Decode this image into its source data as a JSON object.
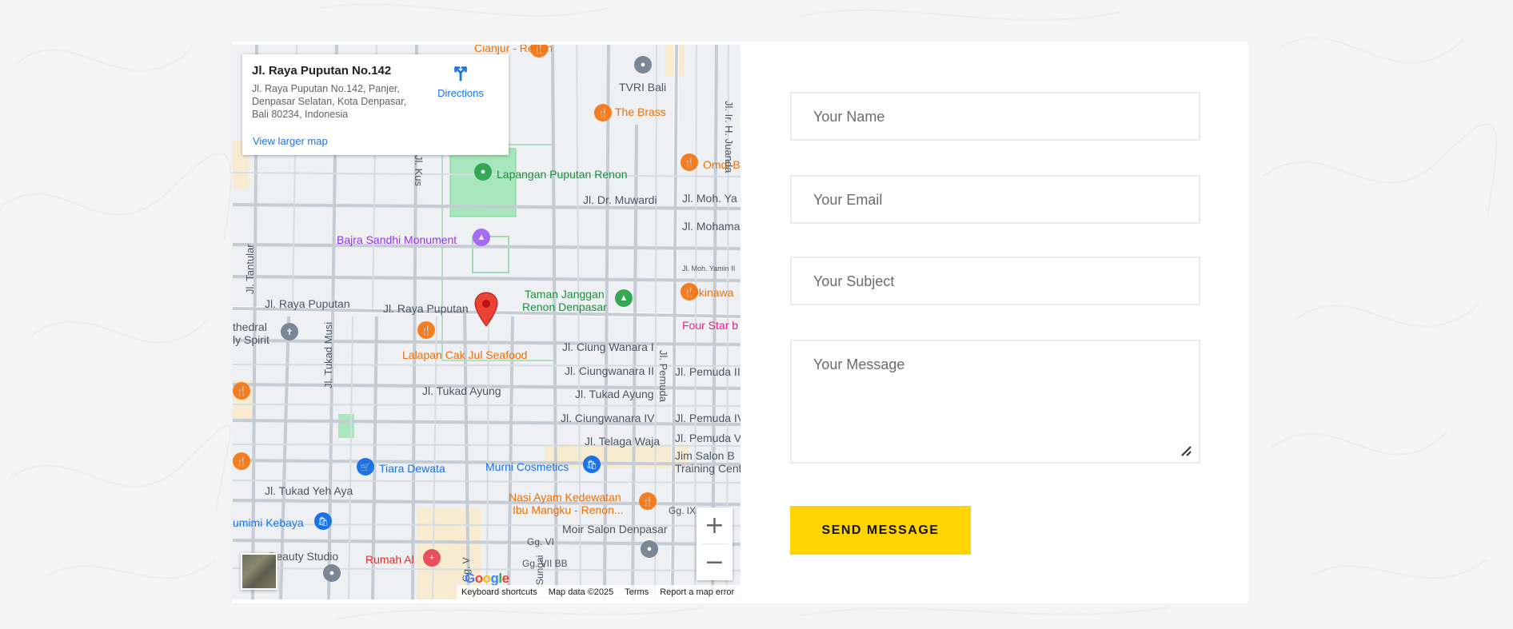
{
  "map": {
    "place_title": "Jl. Raya Puputan No.142",
    "address": "Jl. Raya Puputan No.142, Panjer, Denpasar Selatan, Kota Denpasar, Bali 80234, Indonesia",
    "directions_label": "Directions",
    "view_larger_label": "View larger map",
    "zoom_in": "+",
    "zoom_out": "−",
    "google_logo": "Google",
    "attribution": {
      "shortcuts": "Keyboard shortcuts",
      "map_data": "Map data ©2025",
      "terms": "Terms",
      "report": "Report a map error"
    },
    "labels": {
      "cianjur": "Cianjur - Renon",
      "tvri": "TVRI Bali",
      "the_brass": "The Brass",
      "omdi": "Omdi B",
      "lapangan": "Lapangan Puputan Renon",
      "muwardi": "Jl. Dr. Muwardi",
      "moh_ya": "Jl. Moh. Ya",
      "mohama": "Jl. Mohama",
      "moh_yamin2": "Jl. Moh. Yamin II",
      "bajra": "Bajra Sandhi Monument",
      "okinawa": "Okinawa",
      "taman1": "Taman Janggan",
      "taman2": "Renon Denpasar",
      "raya_puputan1": "Jl. Raya Puputan",
      "raya_puputan2": "Jl. Raya Puputan",
      "four_star": "Four Star b",
      "cathedral1": "thedral",
      "cathedral2": "ly Spirit",
      "lalapan": "Lalapan Cak Jul Seafood",
      "ciung1": "Jl. Ciung Wanara I",
      "ciung2": "Jl. Ciungwanara II",
      "pemuda2": "Jl. Pemuda II",
      "tukad_ayung1": "Jl. Tukad Ayung",
      "tukad_ayung2": "Jl. Tukad Ayung",
      "ciung4": "Jl. Ciungwanara IV",
      "pemuda4": "Jl. Pemuda IV",
      "telaga": "Jl. Telaga Waja",
      "pemuda5": "Jl. Pemuda V",
      "jim1": "Jim Salon B",
      "jim2": "Training Cent",
      "tiara": "Tiara Dewata",
      "murni": "Murni Cosmetics",
      "tukad_yeh": "Jl. Tukad Yeh Aya",
      "nasi1": "Nasi Ayam Kedewatan",
      "nasi2": "Ibu Mangku - Renon...",
      "gg_ix": "Gg. IX",
      "mimi": "umimi Kebaya",
      "moir": "Moir Salon Denpasar",
      "beauty": "Beauty Studio",
      "rumah": "Rumah Al",
      "gg_vi": "Gg. VI",
      "gg_vii": "Gg. VII BB",
      "gg_v": "Gg. V",
      "sungai": "Sungai",
      "juanda": "Jl. Ir. H. Juanda",
      "kusuma": "Jl. Kus",
      "tantular": "Jl. Tantular",
      "tukad_musi": "Jl. Tukad Musi",
      "pemuda": "Jl. Pemuda"
    }
  },
  "form": {
    "name_placeholder": "Your Name",
    "email_placeholder": "Your Email",
    "subject_placeholder": "Your Subject",
    "message_placeholder": "Your Message",
    "submit_label": "SEND MESSAGE"
  },
  "colors": {
    "accent": "#ffd400",
    "link": "#1a73e8",
    "pin": "#ea4335"
  }
}
